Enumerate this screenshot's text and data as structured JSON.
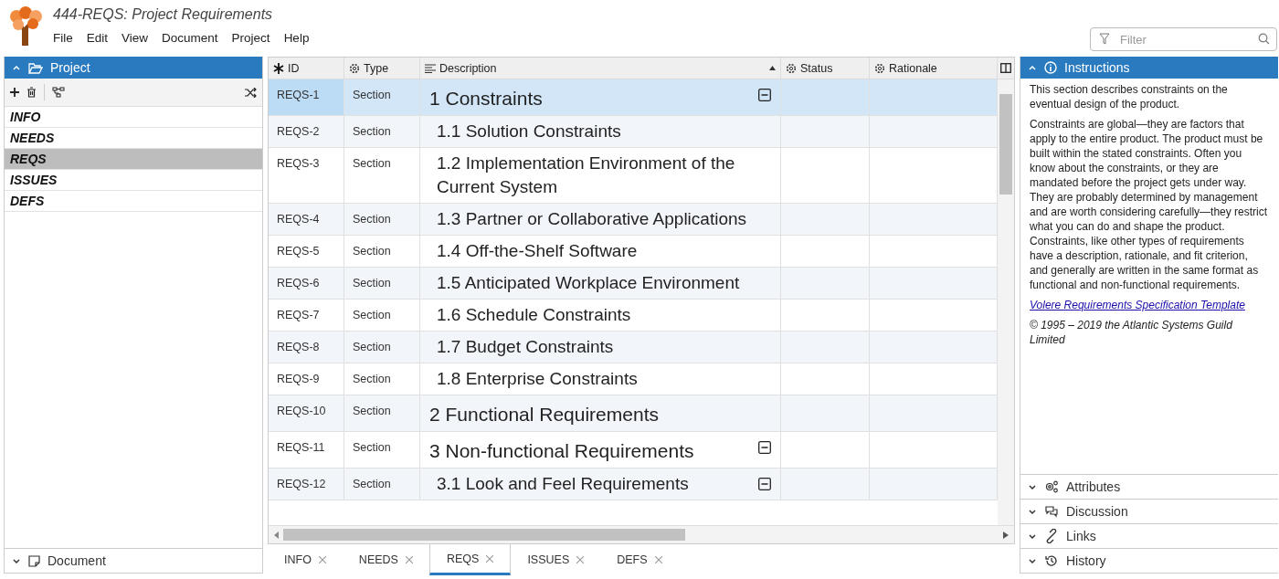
{
  "window": {
    "title": "444-REQS: Project Requirements"
  },
  "menu": [
    "File",
    "Edit",
    "View",
    "Document",
    "Project",
    "Help"
  ],
  "filter": {
    "placeholder": "Filter"
  },
  "project_panel": {
    "title": "Project",
    "expanded": true,
    "documents": [
      {
        "label": "INFO",
        "selected": false
      },
      {
        "label": "NEEDS",
        "selected": false
      },
      {
        "label": "REQS",
        "selected": true
      },
      {
        "label": "ISSUES",
        "selected": false
      },
      {
        "label": "DEFS",
        "selected": false
      }
    ],
    "document_section": {
      "title": "Document",
      "expanded": false
    }
  },
  "table": {
    "columns": [
      {
        "label": "ID",
        "kind": "id"
      },
      {
        "label": "Type",
        "kind": "attr"
      },
      {
        "label": "Description",
        "kind": "text"
      },
      {
        "label": "Status",
        "kind": "attr"
      },
      {
        "label": "Rationale",
        "kind": "attr"
      }
    ],
    "rows": [
      {
        "id": "REQS-1",
        "type": "Section",
        "description": "1 Constraints",
        "selected": true,
        "expanded": true,
        "children": [
          {
            "id": "REQS-2",
            "type": "Section",
            "description": "1.1 Solution Constraints",
            "selected": false,
            "expanded": false
          },
          {
            "id": "REQS-3",
            "type": "Section",
            "description": "1.2 Implementation Environment of the Current System",
            "selected": false,
            "expanded": false
          },
          {
            "id": "REQS-4",
            "type": "Section",
            "description": "1.3 Partner or Collaborative Applications",
            "selected": false,
            "expanded": false
          },
          {
            "id": "REQS-5",
            "type": "Section",
            "description": "1.4 Off-the-Shelf Software",
            "selected": false,
            "expanded": false
          },
          {
            "id": "REQS-6",
            "type": "Section",
            "description": "1.5 Anticipated Workplace Environment",
            "selected": false,
            "expanded": false
          },
          {
            "id": "REQS-7",
            "type": "Section",
            "description": "1.6 Schedule Constraints",
            "selected": false,
            "expanded": false
          },
          {
            "id": "REQS-8",
            "type": "Section",
            "description": "1.7 Budget Constraints",
            "selected": false,
            "expanded": false
          },
          {
            "id": "REQS-9",
            "type": "Section",
            "description": "1.8 Enterprise Constraints",
            "selected": false,
            "expanded": false
          }
        ]
      },
      {
        "id": "REQS-10",
        "type": "Section",
        "description": "2 Functional Requirements",
        "selected": false,
        "expanded": false
      },
      {
        "id": "REQS-11",
        "type": "Section",
        "description": "3 Non-functional Requirements",
        "selected": false,
        "expanded": true,
        "children": [
          {
            "id": "REQS-12",
            "type": "Section",
            "description": "3.1 Look and Feel Requirements",
            "selected": false,
            "expanded": true
          }
        ]
      }
    ]
  },
  "tabs": [
    {
      "label": "INFO",
      "selected": false
    },
    {
      "label": "NEEDS",
      "selected": false
    },
    {
      "label": "REQS",
      "selected": true
    },
    {
      "label": "ISSUES",
      "selected": false
    },
    {
      "label": "DEFS",
      "selected": false
    }
  ],
  "instructions": {
    "title": "Instructions",
    "expanded": true,
    "paragraphs": [
      "This section describes constraints on the eventual design of the product.",
      "Constraints are global—they are factors that apply to the entire product. The product must be built within the stated constraints. Often you know about the constraints, or they are mandated before the project gets under way. They are probably determined by management and are worth considering carefully—they restrict what you can do and shape the product. Constraints, like other types of requirements have a description, rationale, and fit criterion, and generally are written in the same format as functional and non-functional requirements."
    ],
    "link": "Volere Requirements Specification Template",
    "copyright": "© 1995 – 2019 the Atlantic Systems Guild Limited"
  },
  "side_sections": [
    {
      "title": "Attributes",
      "kind": "attributes",
      "expanded": false
    },
    {
      "title": "Discussion",
      "kind": "discussion",
      "expanded": false
    },
    {
      "title": "Links",
      "kind": "links",
      "expanded": false
    },
    {
      "title": "History",
      "kind": "history",
      "expanded": false
    }
  ]
}
